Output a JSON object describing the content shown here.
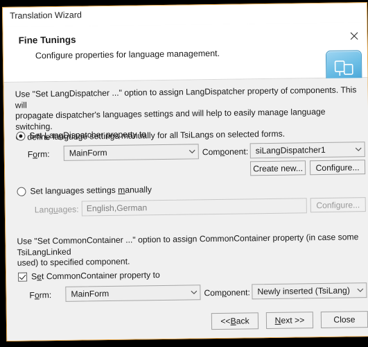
{
  "window": {
    "title": "Translation Wizard",
    "accent_color": "#e8a33d",
    "background": "#f0f0f0"
  },
  "header": {
    "title": "Fine Tunings",
    "subtitle": "Configure properties for language management.",
    "close_label": "close-icon",
    "glyph_name": "two-windows-icon",
    "glyph_color": "#6ebfe6"
  },
  "dispatcher_section": {
    "description": "Use \"Set LangDispatcher ...\" option to assign LangDispatcher property of components. This will\npropagate dispatcher's languages settings and will help to easily manage language switching.\nOr define language settings manually for all TsiLangs on selected forms.",
    "radio_dispatcher": {
      "label_pre": "Set ",
      "label_accel": "L",
      "label_post": "angDispatcher property to",
      "checked": true
    },
    "form_label_pre": "F",
    "form_label_accel": "o",
    "form_label_post": "rm:",
    "form_value": "MainForm",
    "component_label_pre": "Com",
    "component_label_accel": "p",
    "component_label_post": "onent:",
    "component_value": "siLangDispatcher1",
    "create_new_label": "Create new...",
    "configure_label": "Configure...",
    "radio_manual": {
      "label_pre": "Set languages settings ",
      "label_accel": "m",
      "label_post": "anually",
      "checked": false
    },
    "languages_label_pre": "Lang",
    "languages_label_accel": "u",
    "languages_label_post": "ages:",
    "languages_value": "English,German",
    "languages_configure_label": "Configure...",
    "languages_disabled": true
  },
  "container_section": {
    "description": "Use \"Set CommonContainer ...\" option to assign CommonContainer property (in case some TsiLangLinked\nused) to specified component.",
    "checkbox": {
      "label_pre": "S",
      "label_accel": "e",
      "label_post": "t CommonContainer property to",
      "checked": true
    },
    "form_label_pre": "F",
    "form_label_accel": "o",
    "form_label_post": "rm:",
    "form_value": "MainForm",
    "component_label_pre": "Com",
    "component_label_accel": "p",
    "component_label_post": "onent:",
    "component_value": "Newly inserted (TsiLang)"
  },
  "footer": {
    "back_pre": "<< ",
    "back_accel": "B",
    "back_post": "ack",
    "next_pre": "",
    "next_accel": "N",
    "next_post": "ext >>",
    "close_label": "Close"
  }
}
